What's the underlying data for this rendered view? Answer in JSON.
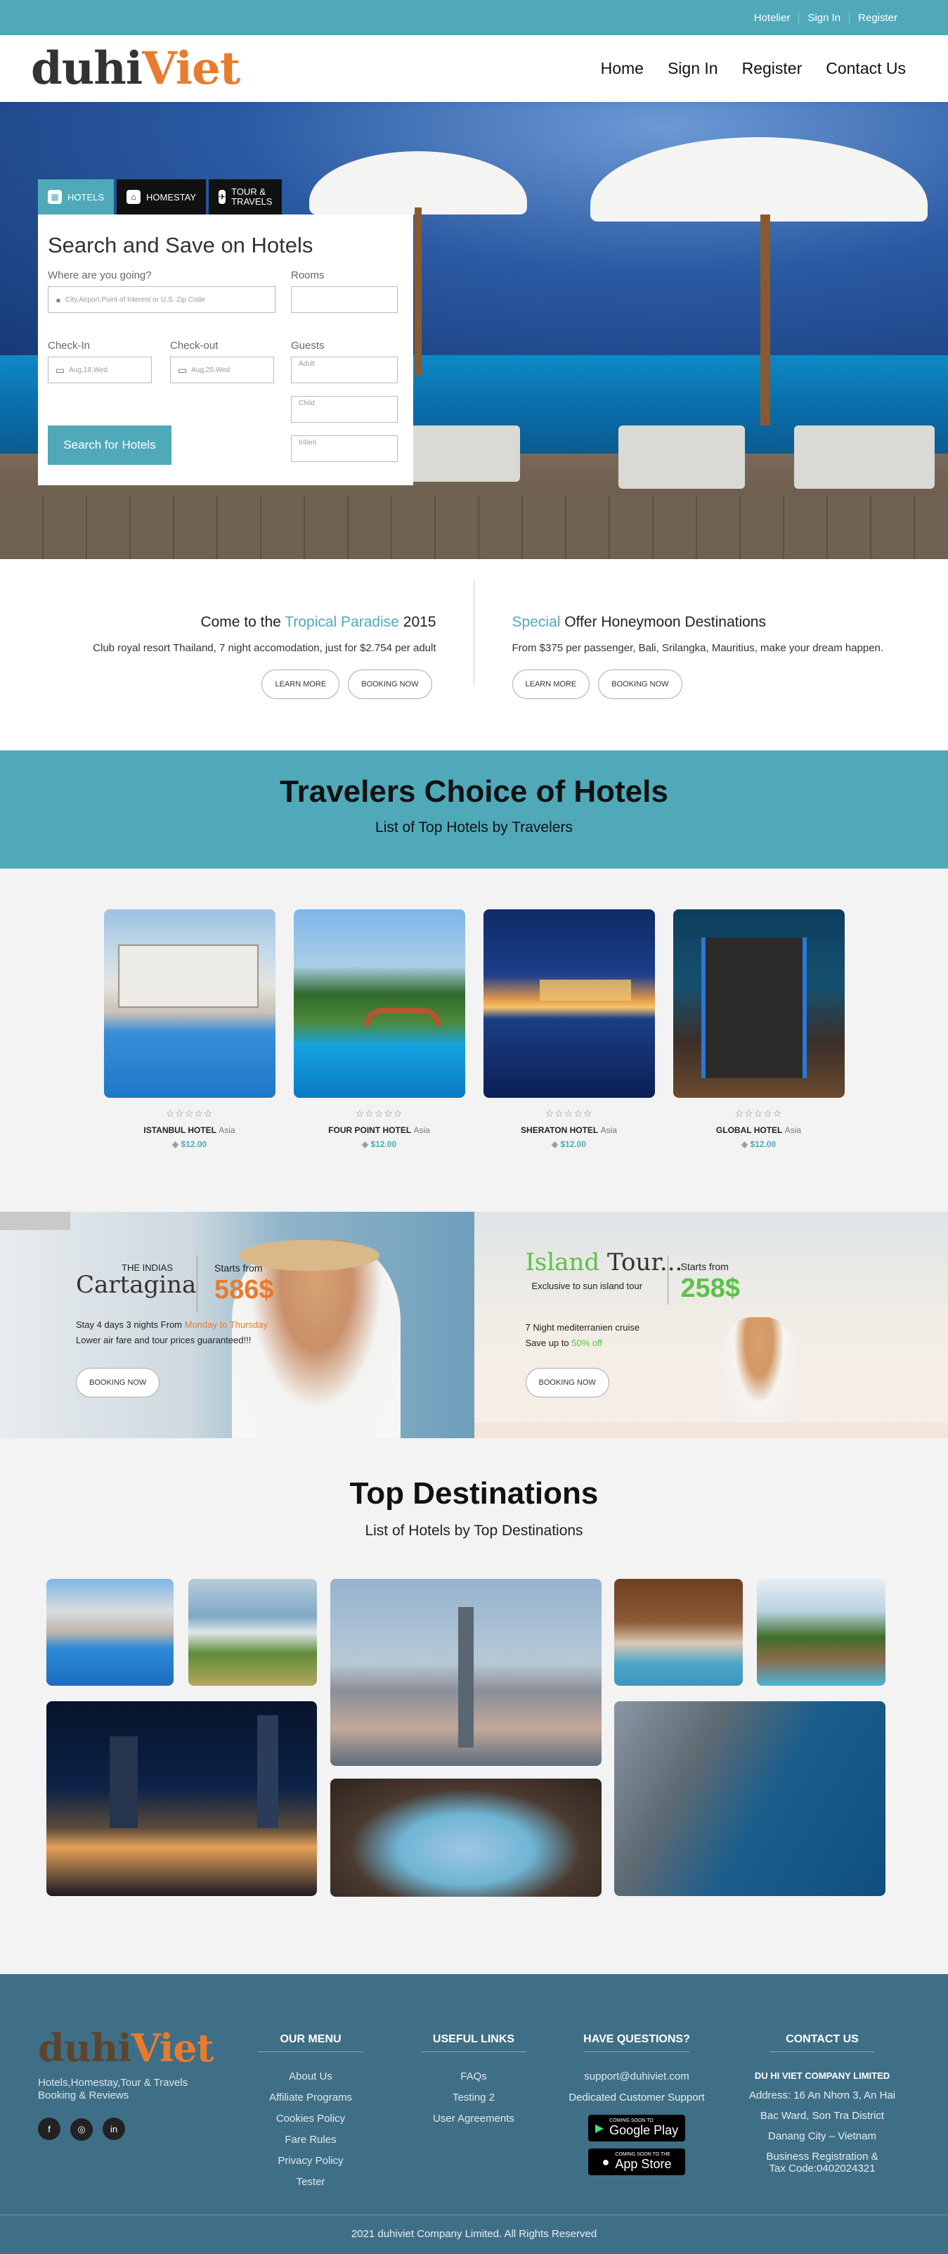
{
  "topbar": {
    "links": [
      "Hotelier",
      "Sign In",
      "Register"
    ]
  },
  "header": {
    "logo_a": "duhi",
    "logo_b": "Viet",
    "nav": [
      "Home",
      "Sign In",
      "Register",
      "Contact Us"
    ]
  },
  "search": {
    "tabs": [
      "HOTELS",
      "HOMESTAY",
      "TOUR & TRAVELS"
    ],
    "title": "Search and Save on Hotels",
    "destination_label": "Where are you going?",
    "destination_placeholder": "City,Airport,Point of Interest or U.S. Zip Code",
    "rooms_label": "Rooms",
    "checkin_label": "Check-In",
    "checkin_value": "Aug,18,Wed",
    "checkout_label": "Check-out",
    "checkout_value": "Aug,25,Wed",
    "guests_label": "Guests",
    "adult": "Adult",
    "child": "Child",
    "infant": "Infant",
    "button": "Search for Hotels"
  },
  "promo": {
    "left": {
      "title_pre": "Come to the ",
      "title_hl": "Tropical Paradise",
      "title_post": " 2015",
      "text": "Club royal resort Thailand, 7 night accomodation, just for $2.754 per adult",
      "btn1": "LEARN MORE",
      "btn2": "BOOKING NOW"
    },
    "right": {
      "title_hl": "Special",
      "title_post": " Offer Honeymoon Destinations",
      "text": "From $375 per passenger, Bali, Srilangka, Mauritius, make your dream happen.",
      "btn1": "LEARN MORE",
      "btn2": "BOOKING NOW"
    }
  },
  "travelers": {
    "title": "Travelers Choice of Hotels",
    "subtitle": "List of Top Hotels by Travelers"
  },
  "hotels": [
    {
      "name": "ISTANBUL HOTEL",
      "region": "Asia",
      "price": "$12.00",
      "stars": "☆☆☆☆☆"
    },
    {
      "name": "FOUR POINT HOTEL",
      "region": "Asia",
      "price": "$12.00",
      "stars": "☆☆☆☆☆"
    },
    {
      "name": "SHERATON HOTEL",
      "region": "Asia",
      "price": "$12.00",
      "stars": "☆☆☆☆☆"
    },
    {
      "name": "GLOBAL HOTEL",
      "region": "Asia",
      "price": "$12.00",
      "stars": "☆☆☆☆☆"
    }
  ],
  "tours": {
    "one": {
      "small": "THE INDIAS",
      "big": "Cartagina",
      "starts": "Starts from",
      "price": "586$",
      "line1_pre": "Stay 4 days 3 nights From ",
      "line1_hl": "Monday to Thursday",
      "line2": "Lower air fare and tour prices guaranteed!!!",
      "button": "BOOKING NOW"
    },
    "two": {
      "big_hl": "Island",
      "big_post": " Tour...",
      "small": "Exclusive to sun island tour",
      "starts": "Starts from",
      "price": "258$",
      "line1": "7 Night mediterranien cruise",
      "line2_pre": "Save up to ",
      "line2_hl": "50% off",
      "button": "BOOKING NOW"
    }
  },
  "destinations": {
    "title": "Top Destinations",
    "subtitle": "List of Hotels by Top Destinations"
  },
  "footer": {
    "logo_a": "duhi",
    "logo_b": "Viet",
    "tagline": "Hotels,Homestay,Tour & Travels Booking & Reviews",
    "social": [
      "f",
      "◎",
      "in"
    ],
    "menu_title": "OUR MENU",
    "menu": [
      "About Us",
      "Affiliate Programs",
      "Cookies Policy",
      "Fare Rules",
      "Privacy Policy",
      "Tester"
    ],
    "useful_title": "USEFUL LINKS",
    "useful": [
      "FAQs",
      "Testing 2",
      "User Agreements"
    ],
    "questions_title": "HAVE QUESTIONS?",
    "email": "support@duhiviet.com",
    "support": "Dedicated Customer Support",
    "gplay_small": "COMING SOON TO",
    "gplay_big": "Google Play",
    "appstore_small": "COMING SOON TO THE",
    "appstore_big": "App Store",
    "contact_title": "CONTACT US",
    "company": "DU HI VIET COMPANY LIMITED",
    "address1": "Address: 16 An Nhơn 3, An Hai",
    "address2": "Bac Ward, Son Tra District",
    "address3": "Danang City – Vietnam",
    "reg1": "Business Registration &",
    "reg2": "Tax Code:0402024321",
    "copyright": "2021 duhiviet Company Limited. All Rights Reserved"
  }
}
